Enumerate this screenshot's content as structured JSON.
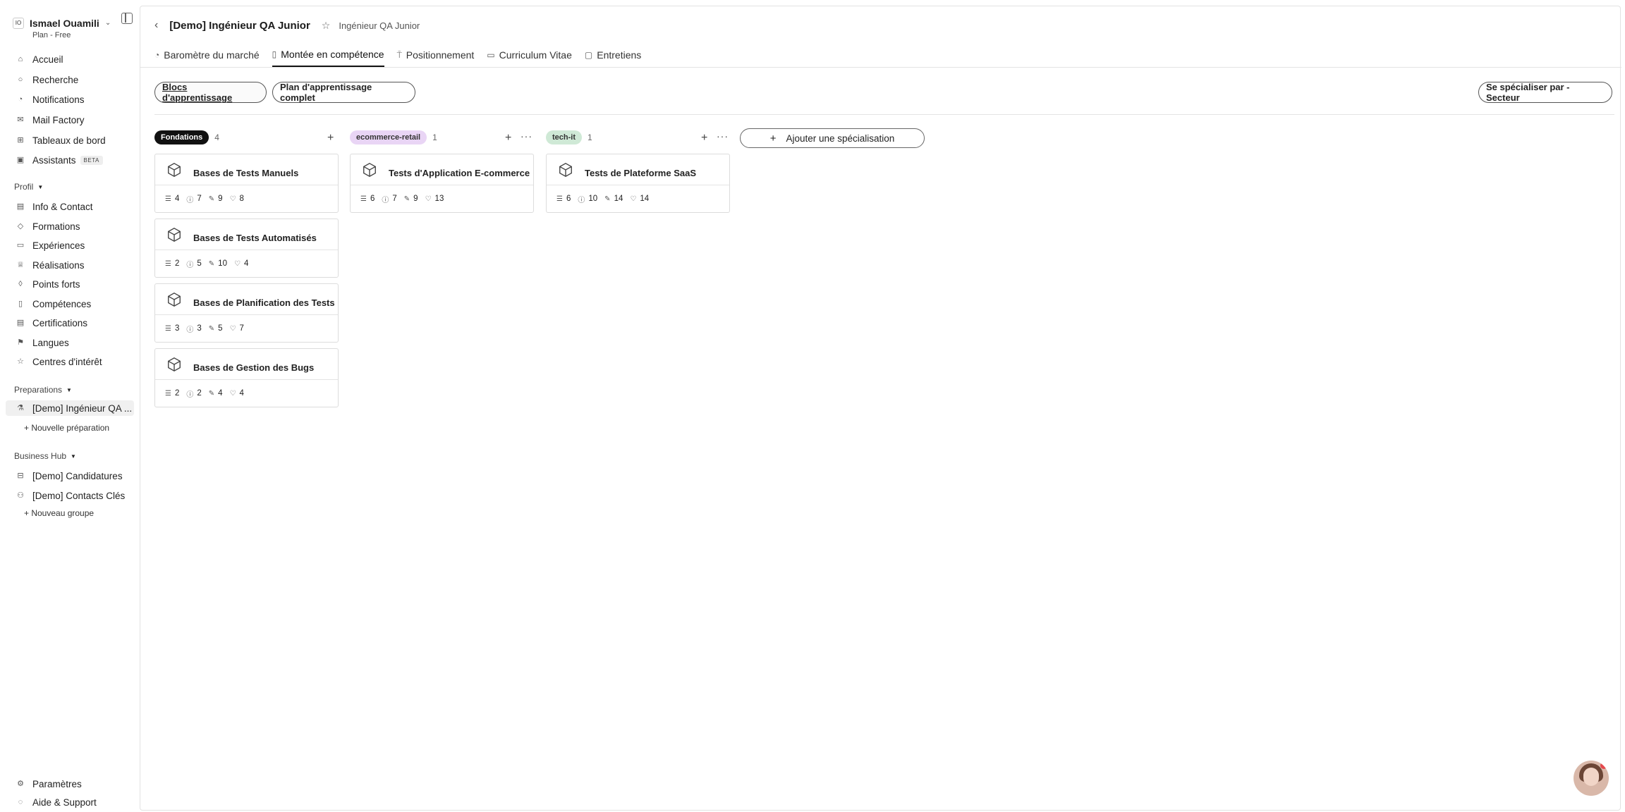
{
  "sidebar": {
    "user": {
      "initials": "IO",
      "name": "Ismael Ouamili",
      "plan": "Plan - Free"
    },
    "nav": [
      {
        "label": "Accueil",
        "icon": "home-icon"
      },
      {
        "label": "Recherche",
        "icon": "search-icon"
      },
      {
        "label": "Notifications",
        "icon": "bell-icon"
      },
      {
        "label": "Mail Factory",
        "icon": "mail-icon"
      },
      {
        "label": "Tableaux de bord",
        "icon": "grid-icon"
      },
      {
        "label": "Assistants",
        "icon": "calendar-icon",
        "badge": "BETA"
      }
    ],
    "profil": {
      "title": "Profil",
      "items": [
        "Info & Contact",
        "Formations",
        "Expériences",
        "Réalisations",
        "Points forts",
        "Compétences",
        "Certifications",
        "Langues",
        "Centres d'intérêt"
      ]
    },
    "preparations": {
      "title": "Preparations",
      "items": [
        "[Demo] Ingénieur QA ..."
      ],
      "add": "+ Nouvelle préparation"
    },
    "business": {
      "title": "Business Hub",
      "items": [
        "[Demo] Candidatures",
        "[Demo] Contacts Clés"
      ],
      "add": "+ Nouveau groupe"
    },
    "footer": [
      "Paramètres",
      "Aide & Support"
    ]
  },
  "header": {
    "title": "[Demo] Ingénieur QA Junior",
    "subtitle": "Ingénieur QA Junior"
  },
  "tabs": [
    "Baromètre du marché",
    "Montée en compétence",
    "Positionnement",
    "Curriculum Vitae",
    "Entretiens"
  ],
  "pills": {
    "blocs": "Blocs d'apprentissage",
    "plan": "Plan d'apprentissage complet",
    "spec": "Se spécialiser par - Secteur"
  },
  "columns": [
    {
      "tag": "Fondations",
      "count": "4",
      "tag_bg": "#111111",
      "tag_fg": "#ffffff",
      "cards": [
        {
          "title": "Bases de Tests Manuels",
          "stats": [
            "4",
            "7",
            "9",
            "8"
          ]
        },
        {
          "title": "Bases de Tests Automatisés",
          "stats": [
            "2",
            "5",
            "10",
            "4"
          ]
        },
        {
          "title": "Bases de Planification des Tests",
          "stats": [
            "3",
            "3",
            "5",
            "7"
          ]
        },
        {
          "title": "Bases de Gestion des Bugs",
          "stats": [
            "2",
            "2",
            "4",
            "4"
          ]
        }
      ]
    },
    {
      "tag": "ecommerce-retail",
      "count": "1",
      "tag_bg": "#e9d5f5",
      "tag_fg": "#333333",
      "cards": [
        {
          "title": "Tests d'Application E-commerce",
          "stats": [
            "6",
            "7",
            "9",
            "13"
          ]
        }
      ]
    },
    {
      "tag": "tech-it",
      "count": "1",
      "tag_bg": "#cfe9d6",
      "tag_fg": "#333333",
      "cards": [
        {
          "title": "Tests de Plateforme SaaS",
          "stats": [
            "6",
            "10",
            "14",
            "14"
          ]
        }
      ]
    }
  ],
  "add_spec": "Ajouter une spécialisation"
}
